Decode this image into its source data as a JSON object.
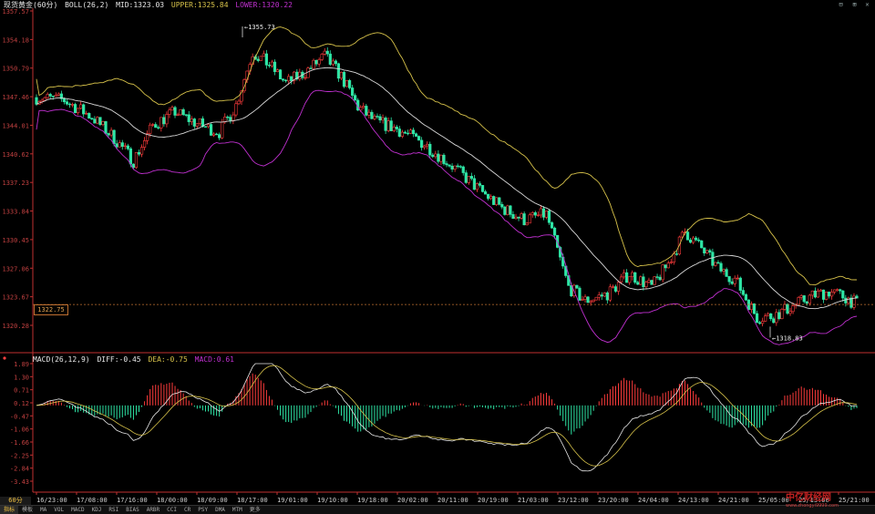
{
  "header": {
    "symbol": "现货黄金(60分)",
    "indicator": "BOLL(26,2)",
    "mid": "MID:1323.03",
    "upper": "UPPER:1325.84",
    "lower": "LOWER:1320.22"
  },
  "macd_header": {
    "name": "MACD(26,12,9)",
    "diff": "DIFF:-0.45",
    "dea": "DEA:-0.75",
    "macd": "MACD:0.61"
  },
  "price_axis": [
    "1357.57",
    "1354.18",
    "1350.79",
    "1347.46",
    "1344.01",
    "1340.62",
    "1337.23",
    "1333.84",
    "1330.45",
    "1327.06",
    "1323.67",
    "1320.28"
  ],
  "macd_axis": [
    "1.89",
    "1.30",
    "0.71",
    "0.12",
    "-0.47",
    "-1.06",
    "-1.66",
    "-2.25",
    "-2.84",
    "-3.43"
  ],
  "time_axis": [
    "16/23:00",
    "17/08:00",
    "17/16:00",
    "18/00:00",
    "18/09:00",
    "18/17:00",
    "19/01:00",
    "19/10:00",
    "19/18:00",
    "20/02:00",
    "20/11:00",
    "20/19:00",
    "21/03:00",
    "23/12:00",
    "23/20:00",
    "24/04:00",
    "24/13:00",
    "24/21:00",
    "25/05:00",
    "25/13:00",
    "25/21:00"
  ],
  "annotations": {
    "high": "1355.73",
    "low": "1318.83"
  },
  "current_price": "1322.75",
  "period_label": "60分",
  "bottom_tabs": [
    "指标",
    "模板",
    "MA",
    "VOL",
    "MACD",
    "KDJ",
    "RSI",
    "BIAS",
    "ARBR",
    "CCI",
    "CR",
    "PSY",
    "DMA",
    "MTM",
    "更多"
  ],
  "window_controls": [
    "⊟",
    "⊞",
    "✕"
  ],
  "logo": {
    "main": "中亿财经网",
    "sub": "www.zhongyi9999.com"
  },
  "colors": {
    "up": "#ff3c3c",
    "down": "#2ee6a6",
    "mid": "#d8d8d8",
    "upper": "#d7c24a",
    "lower": "#c030d0",
    "diff": "#e8e8e8",
    "dea": "#d7c24a",
    "axis": "#c03030"
  }
}
